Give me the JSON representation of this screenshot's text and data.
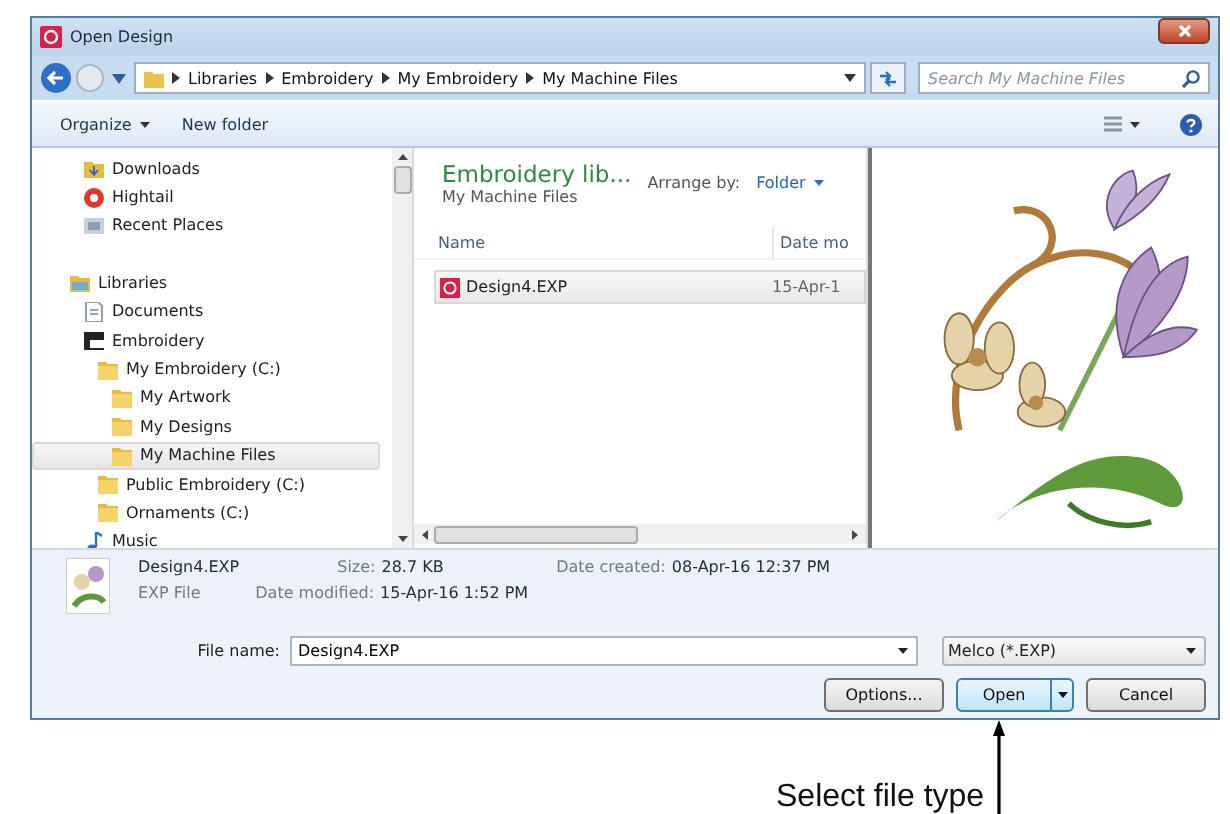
{
  "window": {
    "title": "Open Design"
  },
  "address": {
    "breadcrumbs": [
      "Libraries",
      "Embroidery",
      "My Embroidery",
      "My Machine Files"
    ]
  },
  "search": {
    "placeholder": "Search My Machine Files"
  },
  "toolbar": {
    "organize": "Organize",
    "new_folder": "New folder"
  },
  "navigation": [
    {
      "kind": "favorites",
      "items": [
        {
          "label": "Downloads",
          "kind": "downloads",
          "selected": false
        },
        {
          "label": "Hightail",
          "kind": "app",
          "selected": false
        },
        {
          "label": "Recent Places",
          "kind": "recent",
          "selected": false
        }
      ]
    },
    {
      "kind": "libraries",
      "items": [
        {
          "label": "Libraries",
          "kind": "library",
          "selected": false,
          "children": [
            {
              "label": "Documents",
              "kind": "document",
              "selected": false
            },
            {
              "label": "Embroidery",
              "kind": "machine",
              "selected": false,
              "children": [
                {
                  "label": "My Embroidery (C:)",
                  "kind": "folder",
                  "selected": false,
                  "children": [
                    {
                      "label": "My Artwork",
                      "kind": "folder",
                      "selected": false
                    },
                    {
                      "label": "My Designs",
                      "kind": "folder",
                      "selected": false
                    },
                    {
                      "label": "My Machine Files",
                      "kind": "folder",
                      "selected": true
                    }
                  ]
                },
                {
                  "label": "Public Embroidery (C:)",
                  "kind": "folder",
                  "selected": false
                },
                {
                  "label": "Ornaments (C:)",
                  "kind": "folder",
                  "selected": false
                }
              ]
            },
            {
              "label": "Music",
              "kind": "music",
              "selected": false
            }
          ]
        }
      ]
    }
  ],
  "file_list": {
    "title": "Embroidery lib...",
    "subtitle": "My Machine Files",
    "arrange_label": "Arrange by:",
    "arrange_value": "Folder",
    "columns": [
      "Name",
      "Date mo"
    ],
    "rows": [
      {
        "name": "Design4.EXP",
        "date": "15-Apr-1",
        "selected": true
      }
    ]
  },
  "details": {
    "name": "Design4.EXP",
    "type": "EXP File",
    "size_label": "Size:",
    "size": "28.7 KB",
    "modified_label": "Date modified:",
    "modified": "15-Apr-16 1:52 PM",
    "created_label": "Date created:",
    "created": "08-Apr-16 12:37 PM"
  },
  "file_name": {
    "label": "File name:",
    "value": "Design4.EXP"
  },
  "file_type": {
    "value": "Melco (*.EXP)"
  },
  "buttons": [
    {
      "label": "Options...",
      "kind": "plain"
    },
    {
      "label": "Open",
      "kind": "split"
    },
    {
      "label": "Cancel",
      "kind": "plain"
    }
  ],
  "annotation": {
    "text": "Select file type"
  }
}
